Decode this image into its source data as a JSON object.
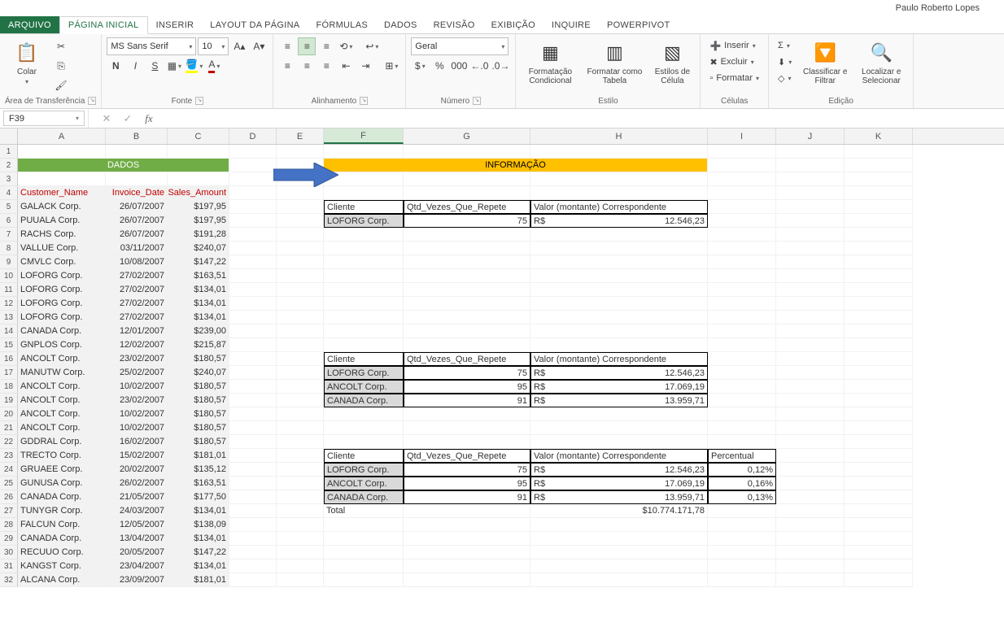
{
  "user_name": "Paulo Roberto Lopes",
  "tabs": {
    "file": "ARQUIVO",
    "home": "PÁGINA INICIAL",
    "insert": "INSERIR",
    "layout": "LAYOUT DA PÁGINA",
    "formulas": "FÓRMULAS",
    "data": "DADOS",
    "review": "REVISÃO",
    "view": "EXIBIÇÃO",
    "inquire": "INQUIRE",
    "powerpivot": "POWERPIVOT"
  },
  "ribbon": {
    "clipboard": {
      "paste": "Colar",
      "label": "Área de Transferência"
    },
    "font": {
      "name": "MS Sans Serif",
      "size": "10",
      "label": "Fonte"
    },
    "align": {
      "label": "Alinhamento"
    },
    "number": {
      "format": "Geral",
      "label": "Número"
    },
    "styles": {
      "cond": "Formatação Condicional",
      "table": "Formatar como Tabela",
      "cell": "Estilos de Célula",
      "label": "Estilo"
    },
    "cells": {
      "insert": "Inserir",
      "delete": "Excluir",
      "format": "Formatar",
      "label": "Células"
    },
    "editing": {
      "sort": "Classificar e Filtrar",
      "find": "Localizar e Selecionar",
      "label": "Edição"
    }
  },
  "name_box": "F39",
  "sheet": {
    "columns": [
      "A",
      "B",
      "C",
      "D",
      "E",
      "F",
      "G",
      "H",
      "I",
      "J",
      "K"
    ],
    "active_col": "F",
    "dados_title": "DADOS",
    "info_title": "INFORMAÇÃO",
    "headers": {
      "customer": "Customer_Name",
      "invoice": "Invoice_Date",
      "sales": "Sales_Amount"
    },
    "rows": [
      {
        "n": 5,
        "a": "GALACK Corp.",
        "b": "26/07/2007",
        "c": "$197,95"
      },
      {
        "n": 6,
        "a": "PUUALA Corp.",
        "b": "26/07/2007",
        "c": "$197,95"
      },
      {
        "n": 7,
        "a": "RACHS Corp.",
        "b": "26/07/2007",
        "c": "$191,28"
      },
      {
        "n": 8,
        "a": "VALLUE Corp.",
        "b": "03/11/2007",
        "c": "$240,07"
      },
      {
        "n": 9,
        "a": "CMVLC Corp.",
        "b": "10/08/2007",
        "c": "$147,22"
      },
      {
        "n": 10,
        "a": "LOFORG Corp.",
        "b": "27/02/2007",
        "c": "$163,51"
      },
      {
        "n": 11,
        "a": "LOFORG Corp.",
        "b": "27/02/2007",
        "c": "$134,01"
      },
      {
        "n": 12,
        "a": "LOFORG Corp.",
        "b": "27/02/2007",
        "c": "$134,01"
      },
      {
        "n": 13,
        "a": "LOFORG Corp.",
        "b": "27/02/2007",
        "c": "$134,01"
      },
      {
        "n": 14,
        "a": "CANADA Corp.",
        "b": "12/01/2007",
        "c": "$239,00"
      },
      {
        "n": 15,
        "a": "GNPLOS Corp.",
        "b": "12/02/2007",
        "c": "$215,87"
      },
      {
        "n": 16,
        "a": "ANCOLT Corp.",
        "b": "23/02/2007",
        "c": "$180,57"
      },
      {
        "n": 17,
        "a": "MANUTW Corp.",
        "b": "25/02/2007",
        "c": "$240,07"
      },
      {
        "n": 18,
        "a": "ANCOLT Corp.",
        "b": "10/02/2007",
        "c": "$180,57"
      },
      {
        "n": 19,
        "a": "ANCOLT Corp.",
        "b": "23/02/2007",
        "c": "$180,57"
      },
      {
        "n": 20,
        "a": "ANCOLT Corp.",
        "b": "10/02/2007",
        "c": "$180,57"
      },
      {
        "n": 21,
        "a": "ANCOLT Corp.",
        "b": "10/02/2007",
        "c": "$180,57"
      },
      {
        "n": 22,
        "a": "GDDRAL Corp.",
        "b": "16/02/2007",
        "c": "$180,57"
      },
      {
        "n": 23,
        "a": "TRECTO Corp.",
        "b": "15/02/2007",
        "c": "$181,01"
      },
      {
        "n": 24,
        "a": "GRUAEE Corp.",
        "b": "20/02/2007",
        "c": "$135,12"
      },
      {
        "n": 25,
        "a": "GUNUSA Corp.",
        "b": "26/02/2007",
        "c": "$163,51"
      },
      {
        "n": 26,
        "a": "CANADA Corp.",
        "b": "21/05/2007",
        "c": "$177,50"
      },
      {
        "n": 27,
        "a": "TUNYGR Corp.",
        "b": "24/03/2007",
        "c": "$134,01"
      },
      {
        "n": 28,
        "a": "FALCUN Corp.",
        "b": "12/05/2007",
        "c": "$138,09"
      },
      {
        "n": 29,
        "a": "CANADA Corp.",
        "b": "13/04/2007",
        "c": "$134,01"
      },
      {
        "n": 30,
        "a": "RECUUO Corp.",
        "b": "20/05/2007",
        "c": "$147,22"
      },
      {
        "n": 31,
        "a": "KANGST Corp.",
        "b": "23/04/2007",
        "c": "$134,01"
      },
      {
        "n": 32,
        "a": "ALCANA Corp.",
        "b": "23/09/2007",
        "c": "$181,01"
      }
    ],
    "info_table_headers": {
      "cliente": "Cliente",
      "qtd": "Qtd_Vezes_Que_Repete",
      "valor": "Valor (montante) Correspondente",
      "percentual": "Percentual"
    },
    "info_table1": [
      {
        "cliente": "LOFORG Corp.",
        "qtd": "75",
        "rs": "R$",
        "val": "12.546,23"
      }
    ],
    "info_table2": [
      {
        "cliente": "LOFORG Corp.",
        "qtd": "75",
        "rs": "R$",
        "val": "12.546,23"
      },
      {
        "cliente": "ANCOLT Corp.",
        "qtd": "95",
        "rs": "R$",
        "val": "17.069,19"
      },
      {
        "cliente": "CANADA Corp.",
        "qtd": "91",
        "rs": "R$",
        "val": "13.959,71"
      }
    ],
    "info_table3": [
      {
        "cliente": "LOFORG Corp.",
        "qtd": "75",
        "rs": "R$",
        "val": "12.546,23",
        "pct": "0,12%"
      },
      {
        "cliente": "ANCOLT Corp.",
        "qtd": "95",
        "rs": "R$",
        "val": "17.069,19",
        "pct": "0,16%"
      },
      {
        "cliente": "CANADA Corp.",
        "qtd": "91",
        "rs": "R$",
        "val": "13.959,71",
        "pct": "0,13%"
      }
    ],
    "total_label": "Total",
    "total_value": "$10.774.171,78"
  }
}
